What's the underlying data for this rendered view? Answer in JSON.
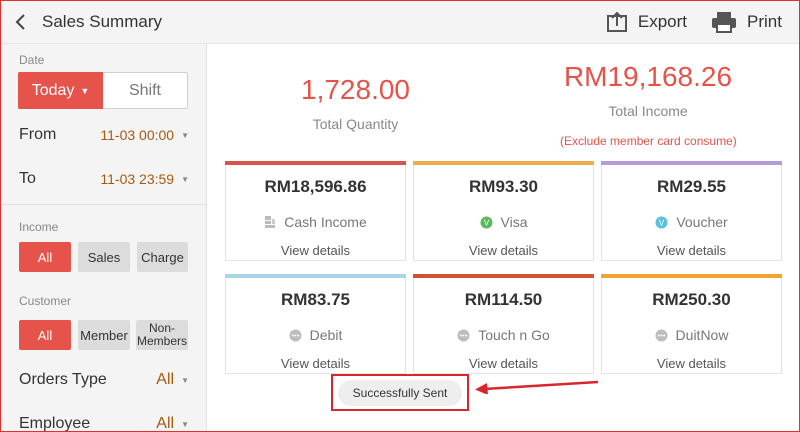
{
  "header": {
    "title": "Sales Summary",
    "export_label": "Export",
    "print_label": "Print"
  },
  "sidebar": {
    "date_label": "Date",
    "today_label": "Today",
    "shift_label": "Shift",
    "from_label": "From",
    "from_value": "11-03 00:00",
    "to_label": "To",
    "to_value": "11-03 23:59",
    "income_label": "Income",
    "income_options": [
      "All",
      "Sales",
      "Charge"
    ],
    "customer_label": "Customer",
    "customer_options": [
      "All",
      "Member",
      "Non-Members"
    ],
    "orders_type_label": "Orders Type",
    "orders_type_value": "All",
    "employee_label": "Employee",
    "employee_value": "All"
  },
  "summary": {
    "total_quantity_value": "1,728.00",
    "total_quantity_label": "Total Quantity",
    "total_income_value": "RM19,168.26",
    "total_income_label": "Total Income",
    "exclude_note": "(Exclude member card consume)"
  },
  "cards": [
    {
      "amount": "RM18,596.86",
      "type": "Cash Income",
      "details": "View details",
      "color": "#d9534f",
      "icon": "cash-icon"
    },
    {
      "amount": "RM93.30",
      "type": "Visa",
      "details": "View details",
      "color": "#f0ad4e",
      "icon": "visa-icon"
    },
    {
      "amount": "RM29.55",
      "type": "Voucher",
      "details": "View details",
      "color": "#b59ad8",
      "icon": "voucher-icon"
    },
    {
      "amount": "RM83.75",
      "type": "Debit",
      "details": "View details",
      "color": "#a9d5e5",
      "icon": "debit-icon"
    },
    {
      "amount": "RM114.50",
      "type": "Touch n Go",
      "details": "View details",
      "color": "#d0532e",
      "icon": "touchngo-icon"
    },
    {
      "amount": "RM250.30",
      "type": "DuitNow",
      "details": "View details",
      "color": "#f0a531",
      "icon": "duitnow-icon"
    }
  ],
  "toast": {
    "message": "Successfully Sent"
  },
  "colors": {
    "accent": "#e5534b",
    "value_text": "#a55a12",
    "annotation": "#d9262c"
  }
}
